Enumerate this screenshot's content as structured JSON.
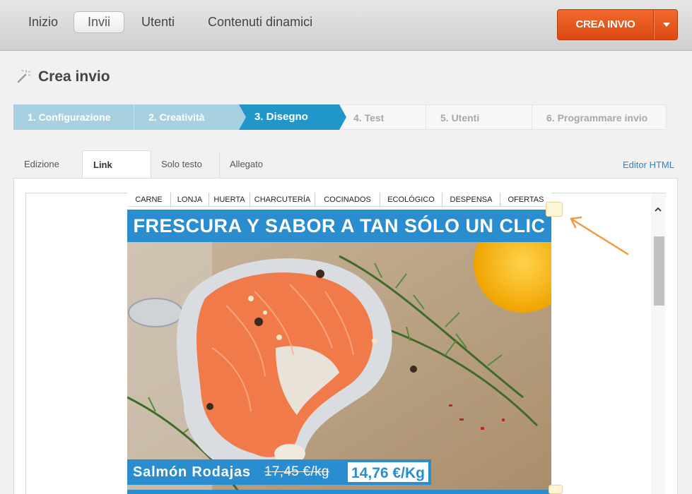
{
  "nav": {
    "items": [
      {
        "label": "Inizio"
      },
      {
        "label": "Invii",
        "active": true
      },
      {
        "label": "Utenti"
      },
      {
        "label": "Contenuti dinamici"
      }
    ],
    "create_button": "CREA INVIO",
    "accent_color": "#e65a1f"
  },
  "page": {
    "title": "Crea invio",
    "title_icon": "magic-wand-icon"
  },
  "wizard": {
    "steps": [
      {
        "label": "1. Configurazione",
        "state": "done"
      },
      {
        "label": "2. Creatività",
        "state": "done"
      },
      {
        "label": "3. Disegno",
        "state": "current"
      },
      {
        "label": "4. Test",
        "state": "todo"
      },
      {
        "label": "5. Utenti",
        "state": "todo"
      },
      {
        "label": "6. Programmare invio",
        "state": "todo"
      }
    ]
  },
  "tabs": {
    "items": [
      {
        "label": "Edizione"
      },
      {
        "label": "Link",
        "active": true
      },
      {
        "label": "Solo testo"
      },
      {
        "label": "Allegato"
      }
    ],
    "html_editor_link": "Editor HTML"
  },
  "newsletter": {
    "menu": [
      "CARNE",
      "LONJA",
      "HUERTA",
      "CHARCUTERÍA",
      "COCINADOS",
      "ECOLÓGICO",
      "DESPENSA",
      "OFERTAS"
    ],
    "banner": "FRESCURA Y SABOR A TAN SÓLO UN CLIC",
    "product": {
      "name": "Salmón Rodajas",
      "old_price": "17,45 €/kg",
      "new_price": "14,76 €/Kg"
    },
    "brand_color": "#2a8dd0"
  }
}
